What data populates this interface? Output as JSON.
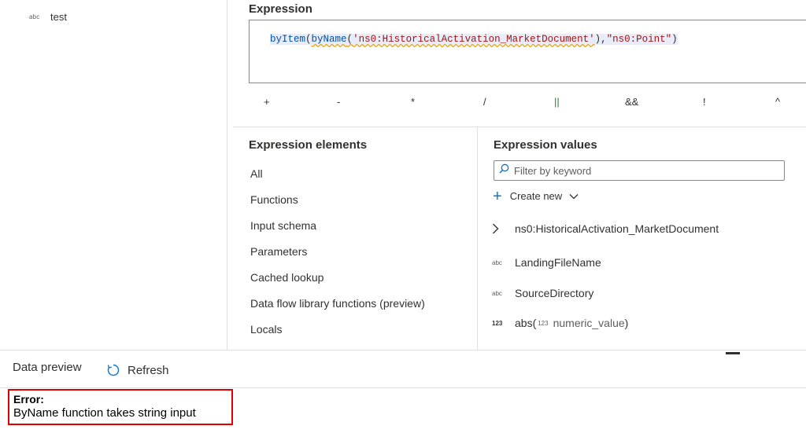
{
  "columns": [
    {
      "type": "abc",
      "name": "test"
    }
  ],
  "expression": {
    "title": "Expression",
    "tokens": {
      "fn1": "byItem",
      "p1": "(",
      "fn2": "byName",
      "p2": "(",
      "str1": "'ns0:HistoricalActivation_MarketDocument'",
      "p3": "),",
      "str2": "\"ns0:Point\"",
      "p4": ")"
    },
    "operators": [
      "+",
      "-",
      "*",
      "/",
      "||",
      "&&",
      "!",
      "^"
    ]
  },
  "expression_elements": {
    "title": "Expression elements",
    "items": [
      "All",
      "Functions",
      "Input schema",
      "Parameters",
      "Cached lookup",
      "Data flow library functions (preview)",
      "Locals"
    ]
  },
  "expression_values": {
    "title": "Expression values",
    "filter_placeholder": "Filter by keyword",
    "create_new": "Create new",
    "items": [
      {
        "type": "",
        "name": "ns0:HistoricalActivation_MarketDocument",
        "icon": "chevron-right-icon"
      },
      {
        "type": "abc",
        "name": "LandingFileName"
      },
      {
        "type": "abc",
        "name": "SourceDirectory"
      },
      {
        "type": "123",
        "name": "abs(",
        "arg_type": "123",
        "arg": "numeric_value",
        "close": ")"
      }
    ]
  },
  "data_preview": {
    "label": "Data preview",
    "refresh": "Refresh",
    "error_title": "Error:",
    "error_message": "ByName function takes string input"
  },
  "colors": {
    "accent": "#0078d4",
    "error_border": "#e00000",
    "string_token": "#a31515",
    "function_token": "#0451a5"
  }
}
